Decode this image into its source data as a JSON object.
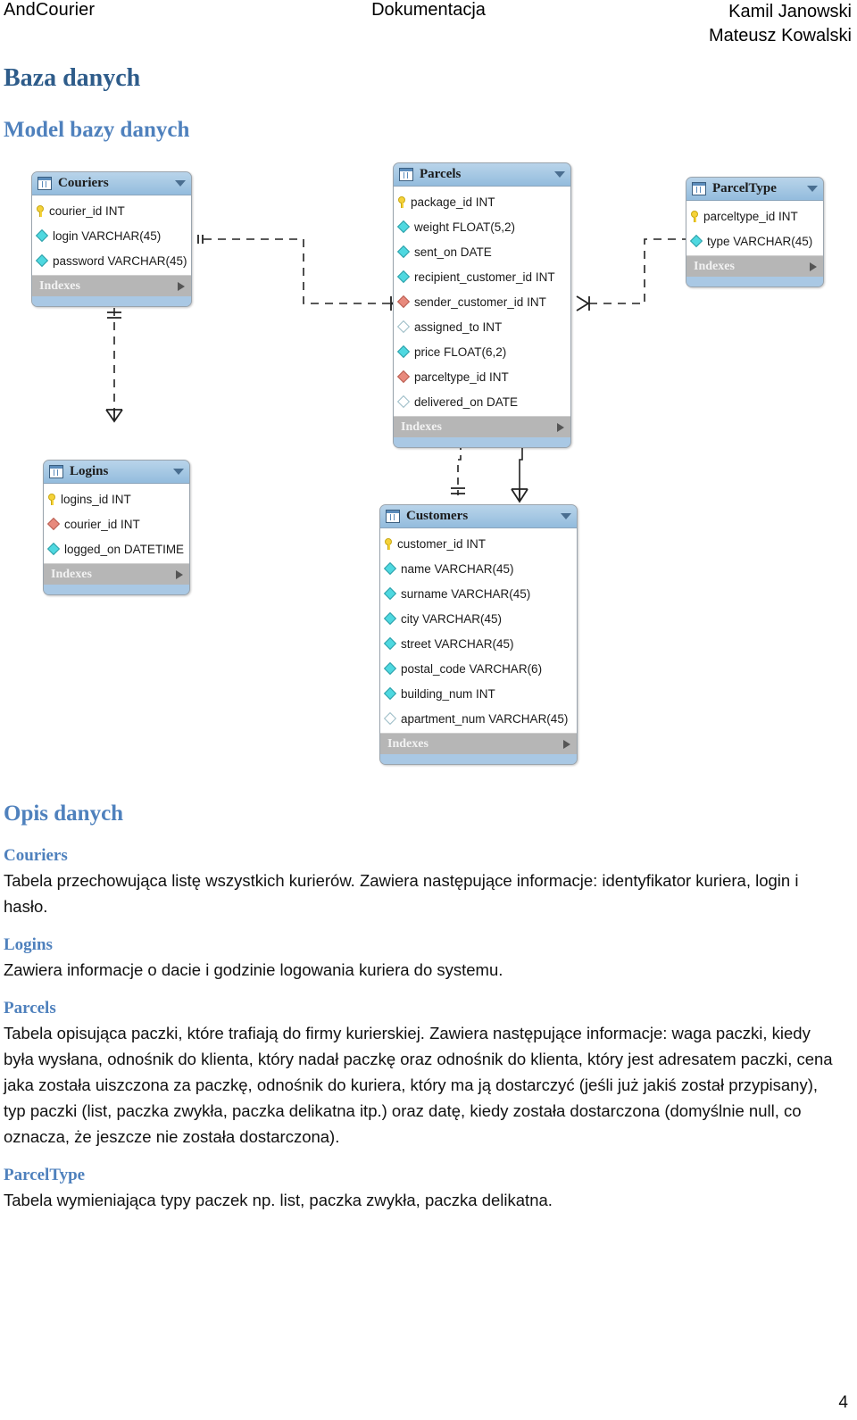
{
  "header": {
    "left": "AndCourier",
    "center": "Dokumentacja",
    "author1": "Kamil Janowski",
    "author2": "Mateusz Kowalski"
  },
  "headings": {
    "h1": "Baza danych",
    "model_section": "Model bazy danych",
    "opis_section": "Opis danych"
  },
  "page_number": "4",
  "colors": {
    "h1": "#2E5C8A",
    "h2": "#4F81BD",
    "h3": "#4F81BD",
    "table_header": "#93BCDD",
    "table_body": "#FFFFFF",
    "indexes_bar": "#B6B6B6",
    "pk_icon": "#F5D23A",
    "notnull_icon": "#4ED8E0",
    "fk_icon": "#E8897C",
    "nullable_icon": "#FFFFFF"
  },
  "diagram": {
    "indexes_label": "Indexes",
    "tables": [
      {
        "id": "couriers",
        "name": "Couriers",
        "fields": [
          {
            "icon": "pk",
            "text": "courier_id INT"
          },
          {
            "icon": "nn",
            "text": "login VARCHAR(45)"
          },
          {
            "icon": "nn",
            "text": "password VARCHAR(45)"
          }
        ]
      },
      {
        "id": "parcels",
        "name": "Parcels",
        "fields": [
          {
            "icon": "pk",
            "text": "package_id INT"
          },
          {
            "icon": "nn",
            "text": "weight FLOAT(5,2)"
          },
          {
            "icon": "nn",
            "text": "sent_on DATE"
          },
          {
            "icon": "nn",
            "text": "recipient_customer_id INT"
          },
          {
            "icon": "fk",
            "text": "sender_customer_id INT"
          },
          {
            "icon": "null",
            "text": "assigned_to INT"
          },
          {
            "icon": "nn",
            "text": "price FLOAT(6,2)"
          },
          {
            "icon": "fk",
            "text": "parceltype_id INT"
          },
          {
            "icon": "null",
            "text": "delivered_on DATE"
          }
        ]
      },
      {
        "id": "parceltype",
        "name": "ParcelType",
        "fields": [
          {
            "icon": "pk",
            "text": "parceltype_id INT"
          },
          {
            "icon": "nn",
            "text": "type VARCHAR(45)"
          }
        ]
      },
      {
        "id": "logins",
        "name": "Logins",
        "fields": [
          {
            "icon": "pk",
            "text": "logins_id INT"
          },
          {
            "icon": "fk",
            "text": "courier_id INT"
          },
          {
            "icon": "nn",
            "text": "logged_on DATETIME"
          }
        ]
      },
      {
        "id": "customers",
        "name": "Customers",
        "fields": [
          {
            "icon": "pk",
            "text": "customer_id INT"
          },
          {
            "icon": "nn",
            "text": "name VARCHAR(45)"
          },
          {
            "icon": "nn",
            "text": "surname VARCHAR(45)"
          },
          {
            "icon": "nn",
            "text": "city VARCHAR(45)"
          },
          {
            "icon": "nn",
            "text": "street VARCHAR(45)"
          },
          {
            "icon": "nn",
            "text": "postal_code VARCHAR(6)"
          },
          {
            "icon": "nn",
            "text": "building_num INT"
          },
          {
            "icon": "null",
            "text": "apartment_num VARCHAR(45)"
          }
        ]
      }
    ],
    "relations": [
      {
        "from": "Couriers",
        "to": "Parcels",
        "style": "dashed"
      },
      {
        "from": "Parcels",
        "to": "ParcelType",
        "style": "dashed"
      },
      {
        "from": "Couriers",
        "to": "Logins",
        "style": "dashed"
      },
      {
        "from": "Parcels",
        "to": "Customers",
        "style": "dashed"
      },
      {
        "from": "Parcels",
        "to": "Customers",
        "style": "solid"
      }
    ]
  },
  "descriptions": [
    {
      "title": "Couriers",
      "text": "Tabela przechowująca listę wszystkich kurierów. Zawiera następujące informacje: identyfikator kuriera, login i hasło."
    },
    {
      "title": "Logins",
      "text": "Zawiera informacje o dacie i godzinie logowania kuriera do systemu."
    },
    {
      "title": "Parcels",
      "text": "Tabela opisująca paczki, które trafiają do firmy kurierskiej. Zawiera następujące informacje: waga paczki, kiedy była wysłana, odnośnik do klienta, który nadał paczkę oraz odnośnik do klienta, który jest adresatem paczki, cena jaka została uiszczona za paczkę, odnośnik do kuriera, który ma ją dostarczyć (jeśli już jakiś został przypisany), typ paczki (list, paczka zwykła, paczka delikatna itp.) oraz datę, kiedy została dostarczona (domyślnie null, co oznacza, że jeszcze nie została dostarczona)."
    },
    {
      "title": "ParcelType",
      "text": "Tabela wymieniająca typy paczek np. list, paczka zwykła, paczka delikatna."
    }
  ]
}
